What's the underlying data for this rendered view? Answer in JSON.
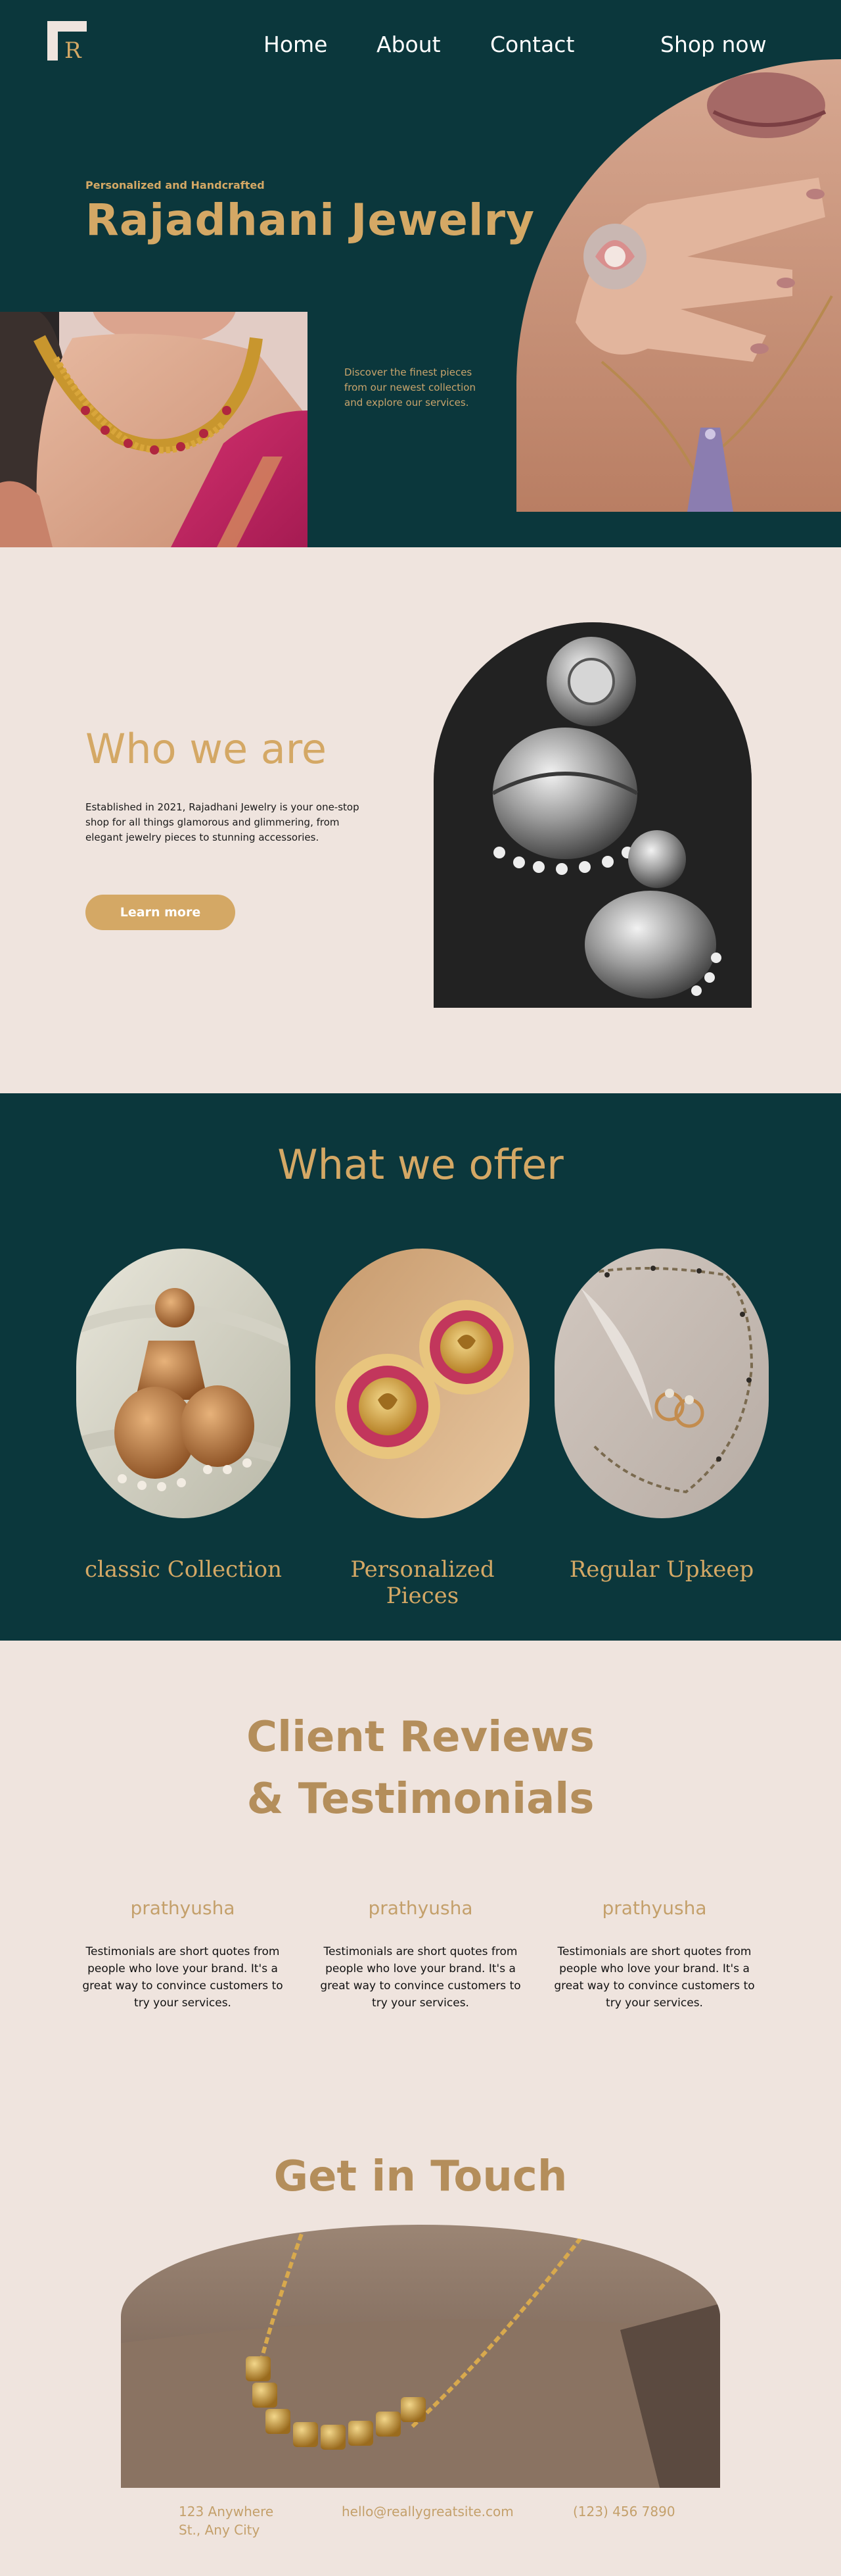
{
  "nav": {
    "logo_letter": "R",
    "items": [
      {
        "label": "Home"
      },
      {
        "label": "About"
      },
      {
        "label": "Contact"
      }
    ],
    "shop_label": "Shop now"
  },
  "hero": {
    "kicker": "Personalized and Handcrafted",
    "title": "Rajadhani Jewelry",
    "description": "Discover the finest pieces from our newest collection and explore our services."
  },
  "about": {
    "title": "Who we are",
    "text": "Established in 2021, Rajadhani Jewelry is your one-stop shop for all things glamorous and glimmering, from elegant jewelry pieces to stunning accessories.",
    "button_label": "Learn more"
  },
  "offer": {
    "title": "What we offer",
    "items": [
      {
        "label": "classic Collection"
      },
      {
        "label": "Personalized Pieces"
      },
      {
        "label": "Regular Upkeep"
      }
    ]
  },
  "reviews": {
    "title_line1": "Client Reviews",
    "title_line2": "& Testimonials",
    "items": [
      {
        "name": "prathyusha",
        "text": "Testimonials are short quotes from people who love your brand. It's a great way to convince customers to try your services."
      },
      {
        "name": "prathyusha",
        "text": "Testimonials are short quotes from people who love your brand. It's a great way to convince customers to try your services."
      },
      {
        "name": "prathyusha",
        "text": "Testimonials are short quotes from people who love your brand. It's a great way to convince customers to try your services."
      }
    ]
  },
  "contact": {
    "title": "Get in Touch",
    "address": "123 Anywhere St., Any City",
    "email": "hello@reallygreatsite.com",
    "phone": "(123) 456 7890"
  },
  "colors": {
    "dark_teal": "#0b373c",
    "gold": "#d4a865",
    "cream": "#efe4de",
    "muted_gold": "#b48e5b"
  }
}
